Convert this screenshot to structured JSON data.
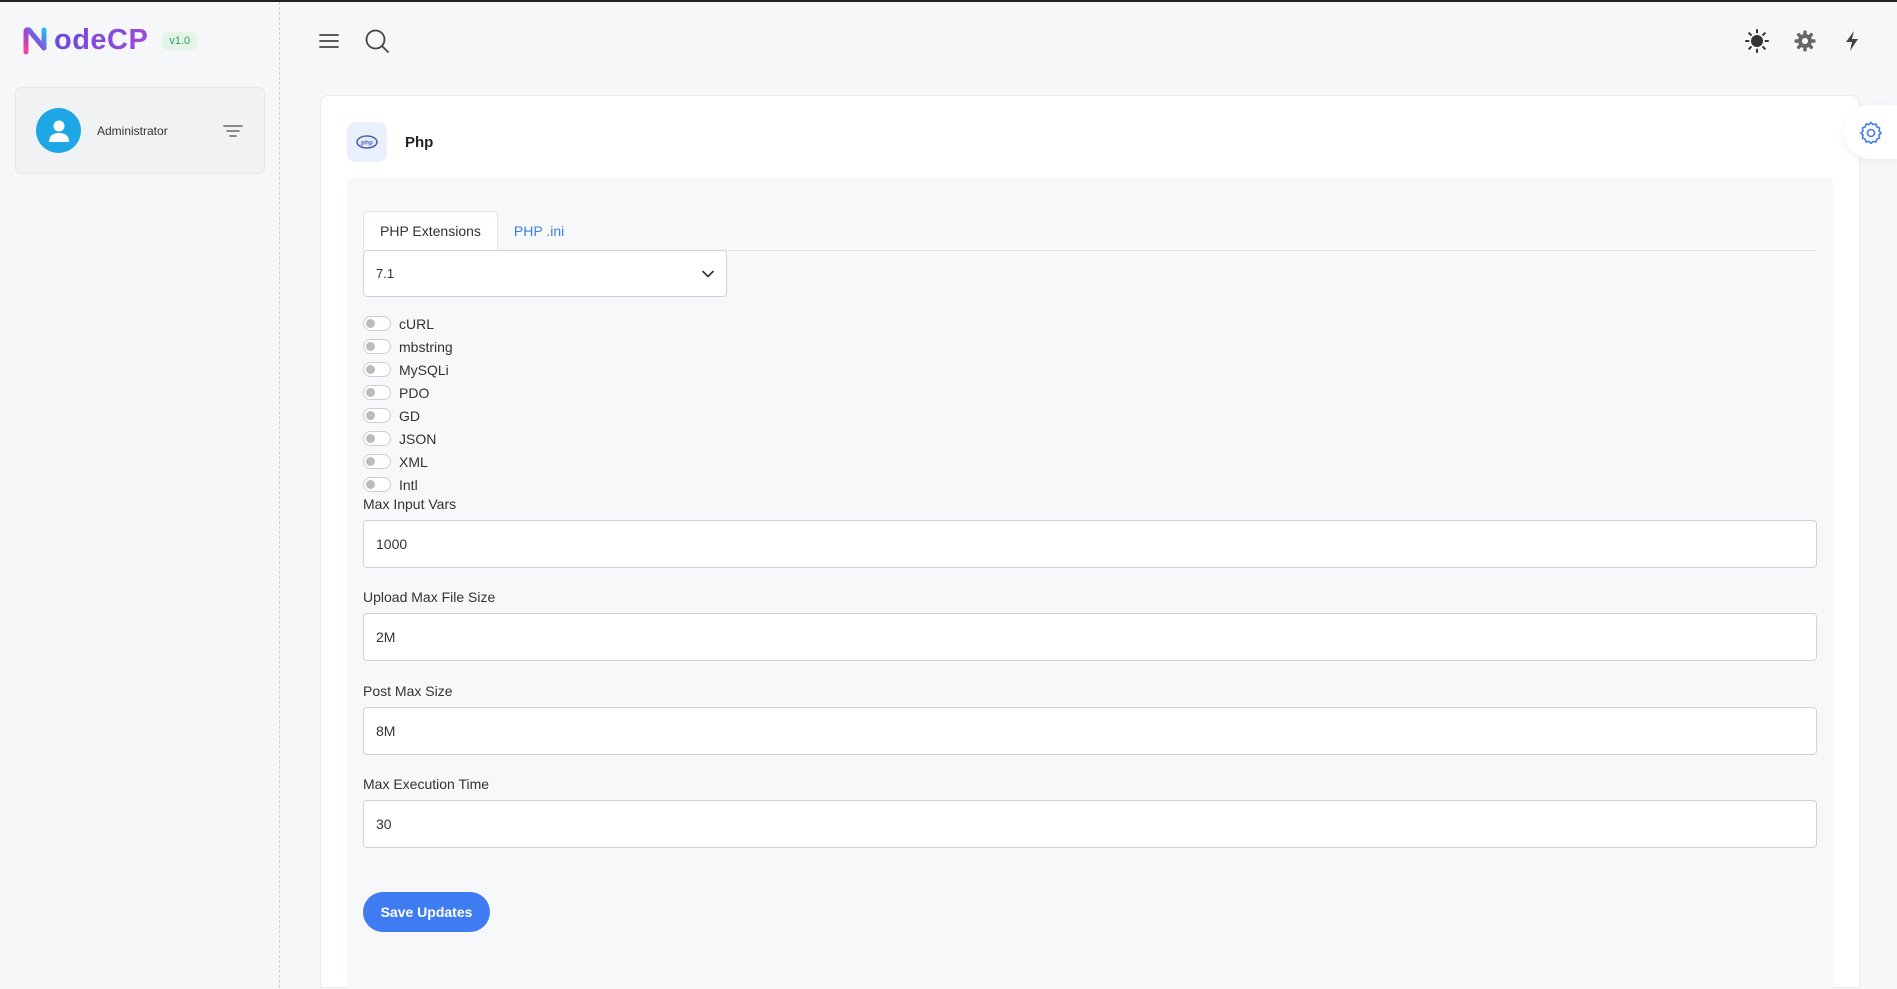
{
  "app": {
    "logo_text": "odeCP",
    "version": "v1.0"
  },
  "user": {
    "name": "Administrator"
  },
  "page": {
    "title": "Php"
  },
  "tabs": [
    {
      "label": "PHP Extensions",
      "active": true
    },
    {
      "label": "PHP .ini",
      "active": false
    }
  ],
  "version_select": {
    "value": "7.1"
  },
  "extensions": [
    {
      "label": "cURL",
      "enabled": false
    },
    {
      "label": "mbstring",
      "enabled": false
    },
    {
      "label": "MySQLi",
      "enabled": false
    },
    {
      "label": "PDO",
      "enabled": false
    },
    {
      "label": "GD",
      "enabled": false
    },
    {
      "label": "JSON",
      "enabled": false
    },
    {
      "label": "XML",
      "enabled": false
    },
    {
      "label": "Intl",
      "enabled": false
    }
  ],
  "fields": {
    "max_input_vars": {
      "label": "Max Input Vars",
      "value": "1000"
    },
    "upload_max_filesize": {
      "label": "Upload Max File Size",
      "value": "2M"
    },
    "post_max_size": {
      "label": "Post Max Size",
      "value": "8M"
    },
    "max_execution_time": {
      "label": "Max Execution Time",
      "value": "30"
    }
  },
  "actions": {
    "save_label": "Save Updates"
  },
  "colors": {
    "accent": "#3f7cf1",
    "link": "#3b7de0",
    "avatar": "#1ea7e4"
  },
  "icons": {
    "menu": "hamburger-icon",
    "search": "search-icon",
    "theme": "sun-icon",
    "settings": "gear-icon",
    "power": "bolt-icon"
  }
}
